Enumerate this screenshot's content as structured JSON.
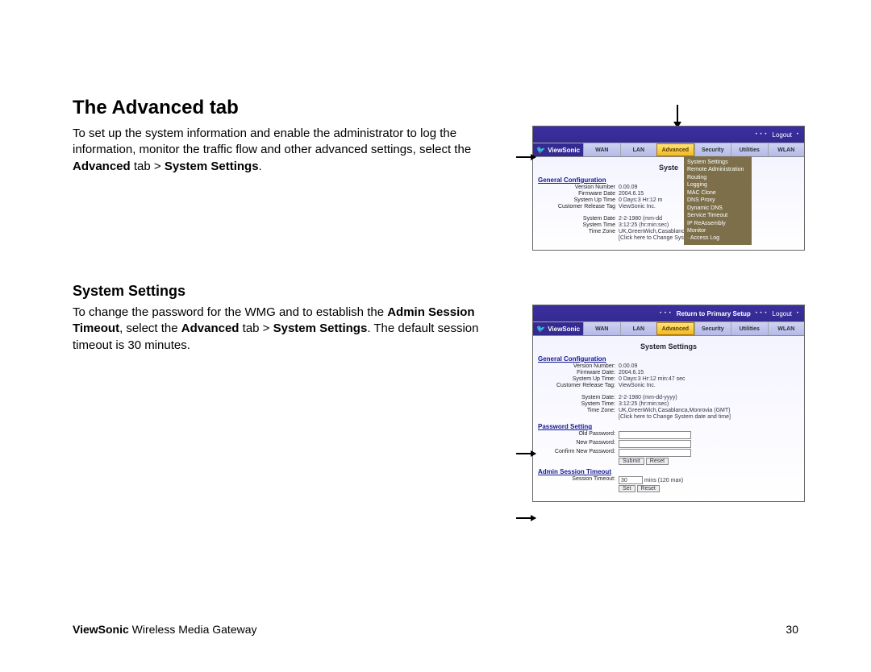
{
  "page": {
    "heading1": "The Advanced tab",
    "para1_a": "To set up the system information and enable the administrator to log the information, monitor the traffic flow and other advanced settings, select the ",
    "para1_b": "Advanced",
    "para1_c": " tab > ",
    "para1_d": "System Settings",
    "para1_e": ".",
    "heading2": "System Settings",
    "para2_a": "To change the password for the WMG and to establish the ",
    "para2_b": "Admin Session Timeout",
    "para2_c": ", select the ",
    "para2_d": "Advanced",
    "para2_e": " tab > ",
    "para2_f": "System Settings",
    "para2_g": ". The default session timeout is 30 minutes.",
    "footer_brand": "ViewSonic",
    "footer_rest": " Wireless Media Gateway",
    "footer_page": "30"
  },
  "shot1": {
    "brand": "ViewSonic",
    "logout": "Logout",
    "tabs": [
      "WAN",
      "LAN",
      "Advanced",
      "Security",
      "Utilities",
      "WLAN"
    ],
    "title": "Syste",
    "group1": "General Configuration",
    "rows1": [
      [
        "Version Number",
        "0.00.09"
      ],
      [
        "Firmware Date",
        "2004.6.15"
      ],
      [
        "System Up Time",
        "0 Days:3 Hr:12 m"
      ],
      [
        "Customer Release Tag",
        "ViewSonic Inc."
      ]
    ],
    "rows2": [
      [
        "System Date",
        "2-2-1980 (mm-dd"
      ],
      [
        "System Time",
        "3:12:25 (hr:min:sec)"
      ],
      [
        "Time Zone",
        "UK,GreenWich,Casablanca,Monrovia (GMT)"
      ]
    ],
    "link": "[Click here to Change System date and time]",
    "dropdown": [
      "System Settings",
      "Remote Administration",
      "Routing",
      "Logging",
      "MAC Clone",
      "DNS Proxy",
      "Dynamic DNS",
      "Service Timeout",
      "IP ReAssembly",
      "Monitor",
      "· Access Log"
    ]
  },
  "shot2": {
    "brand": "ViewSonic",
    "return": "Return to Primary Setup",
    "logout": "Logout",
    "tabs": [
      "WAN",
      "LAN",
      "Advanced",
      "Security",
      "Utilities",
      "WLAN"
    ],
    "title": "System Settings",
    "group1": "General Configuration",
    "rows1": [
      [
        "Version Number:",
        "0.00.09"
      ],
      [
        "Firmware Date:",
        "2004.6.15"
      ],
      [
        "System Up Time:",
        "0 Days:3 Hr:12 min:47 sec"
      ],
      [
        "Customer Release Tag:",
        "ViewSonic Inc."
      ]
    ],
    "rows2": [
      [
        "System Date:",
        "2-2-1980 (mm-dd-yyyy)"
      ],
      [
        "System Time:",
        "3:12:25 (hr:min:sec)"
      ],
      [
        "Time Zone:",
        "UK,GreenWich,Casablanca,Monrovia (GMT)"
      ]
    ],
    "link": "[Click here to Change System date and time]",
    "group2": "Password Setting",
    "pw": [
      "Old Password:",
      "New Password:",
      "Confirm New Password:"
    ],
    "btn_submit": "Submit",
    "btn_reset": "Reset",
    "group3": "Admin Session Timeout",
    "timeout_label": "Session Timeout:",
    "timeout_value": "30",
    "timeout_suffix": "mins (120 max)",
    "btn_set": "Set",
    "btn_reset2": "Reset"
  }
}
